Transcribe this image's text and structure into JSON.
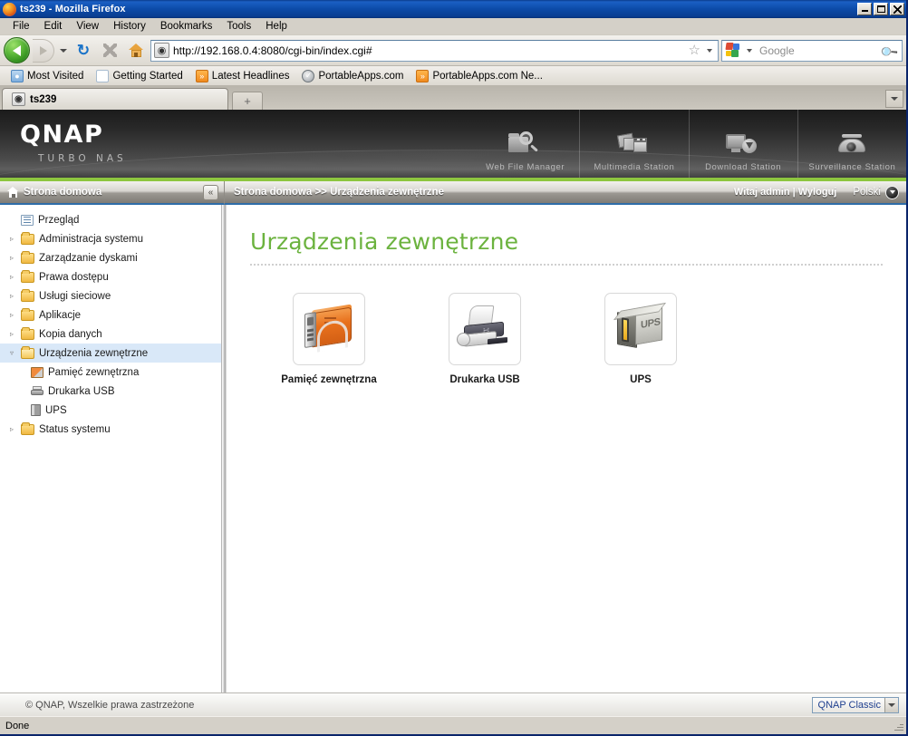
{
  "browser": {
    "window_title": "ts239 - Mozilla Firefox",
    "menu": [
      {
        "label": "File"
      },
      {
        "label": "Edit"
      },
      {
        "label": "View"
      },
      {
        "label": "History"
      },
      {
        "label": "Bookmarks"
      },
      {
        "label": "Tools"
      },
      {
        "label": "Help"
      }
    ],
    "url": "http://192.168.0.4:8080/cgi-bin/index.cgi#",
    "search_placeholder": "Google",
    "bookmarks": [
      {
        "label": "Most Visited",
        "icon": "folder-icon"
      },
      {
        "label": "Getting Started",
        "icon": "page-icon"
      },
      {
        "label": "Latest Headlines",
        "icon": "rss-icon"
      },
      {
        "label": "PortableApps.com",
        "icon": "portableapps-icon"
      },
      {
        "label": "PortableApps.com Ne...",
        "icon": "rss-icon"
      }
    ],
    "tab_title": "ts239",
    "new_tab_glyph": "+",
    "status_text": "Done",
    "window_buttons": {
      "minimize": "_",
      "maximize": "□",
      "close": "×"
    }
  },
  "qnap": {
    "logo": "QNAP",
    "subtitle": "TURBO NAS",
    "accent_color": "#8dc63f",
    "heading_color": "#6cb33f",
    "stations": [
      {
        "label": "Web File Manager",
        "icon": "web-file-manager-icon"
      },
      {
        "label": "Multimedia Station",
        "icon": "multimedia-station-icon"
      },
      {
        "label": "Download Station",
        "icon": "download-station-icon"
      },
      {
        "label": "Surveillance Station",
        "icon": "surveillance-station-icon"
      }
    ],
    "sidebar_header": "Strona domowa",
    "collapse_glyph": "«",
    "breadcrumb": "Strona domowa >> Urządzenia zewnętrzne",
    "greeting": "Witaj admin | Wyloguj",
    "language": "Polski",
    "tree": [
      {
        "label": "Przegląd",
        "icon": "overview-icon",
        "twist": "",
        "level": 0,
        "selected": false
      },
      {
        "label": "Administracja systemu",
        "icon": "folder-icon",
        "twist": "▹",
        "level": 0,
        "selected": false
      },
      {
        "label": "Zarządzanie dyskami",
        "icon": "folder-icon",
        "twist": "▹",
        "level": 0,
        "selected": false
      },
      {
        "label": "Prawa dostępu",
        "icon": "folder-icon",
        "twist": "▹",
        "level": 0,
        "selected": false
      },
      {
        "label": "Usługi sieciowe",
        "icon": "folder-icon",
        "twist": "▹",
        "level": 0,
        "selected": false
      },
      {
        "label": "Aplikacje",
        "icon": "folder-icon",
        "twist": "▹",
        "level": 0,
        "selected": false
      },
      {
        "label": "Kopia danych",
        "icon": "folder-icon",
        "twist": "▹",
        "level": 0,
        "selected": false
      },
      {
        "label": "Urządzenia zewnętrzne",
        "icon": "folder-open-icon",
        "twist": "▿",
        "level": 0,
        "selected": true
      },
      {
        "label": "Pamięć zewnętrzna",
        "icon": "external-storage-icon",
        "twist": "",
        "level": 1,
        "selected": false
      },
      {
        "label": "Drukarka USB",
        "icon": "usb-printer-icon",
        "twist": "",
        "level": 1,
        "selected": false
      },
      {
        "label": "UPS",
        "icon": "ups-icon",
        "twist": "",
        "level": 1,
        "selected": false
      },
      {
        "label": "Status systemu",
        "icon": "folder-icon",
        "twist": "▹",
        "level": 0,
        "selected": false
      }
    ],
    "page_title": "Urządzenia zewnętrzne",
    "devices": [
      {
        "label": "Pamięć zewnętrzna",
        "icon": "external-storage-icon"
      },
      {
        "label": "Drukarka USB",
        "icon": "usb-printer-icon"
      },
      {
        "label": "UPS",
        "icon": "ups-icon"
      }
    ],
    "copyright": "© QNAP, Wszelkie prawa zastrzeżone",
    "theme": "QNAP Classic"
  }
}
